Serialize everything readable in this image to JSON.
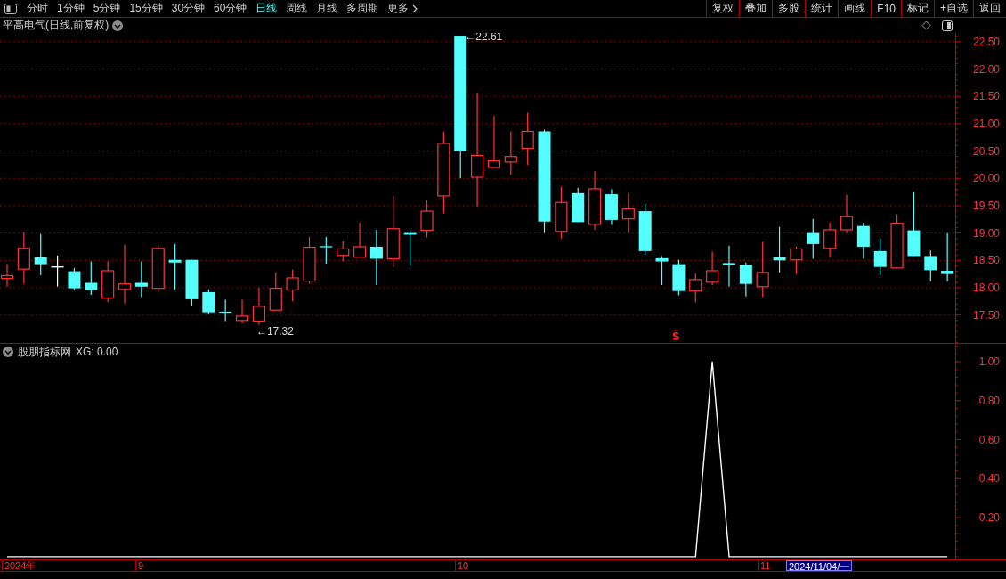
{
  "toolbar": {
    "periods": [
      {
        "label": "分时",
        "selected": false
      },
      {
        "label": "1分钟",
        "selected": false
      },
      {
        "label": "5分钟",
        "selected": false
      },
      {
        "label": "15分钟",
        "selected": false
      },
      {
        "label": "30分钟",
        "selected": false
      },
      {
        "label": "60分钟",
        "selected": false
      },
      {
        "label": "日线",
        "selected": true
      },
      {
        "label": "周线",
        "selected": false
      },
      {
        "label": "月线",
        "selected": false
      },
      {
        "label": "多周期",
        "selected": false
      }
    ],
    "more": "更多",
    "actions": [
      "复权",
      "叠加",
      "多股",
      "统计",
      "画线",
      "F10",
      "标记",
      "+自选",
      "返回"
    ]
  },
  "main_panel": {
    "title": "平高电气(日线,前复权)",
    "chart_data": {
      "type": "candlestick",
      "grid": true,
      "ylim": [
        16.99,
        22.66
      ],
      "yticks": [
        {
          "value": 17.5,
          "label": "17.50"
        },
        {
          "value": 18,
          "label": "18.00"
        },
        {
          "value": 18.5,
          "label": "18.50"
        },
        {
          "value": 19,
          "label": "19.00"
        },
        {
          "value": 19.5,
          "label": "19.50"
        },
        {
          "value": 20,
          "label": "20.00"
        },
        {
          "value": 20.5,
          "label": "20.50"
        },
        {
          "value": 21,
          "label": "21.00"
        },
        {
          "value": 21.5,
          "label": "21.50"
        },
        {
          "value": 22,
          "label": "22.00"
        },
        {
          "value": 22.5,
          "label": "22.50"
        }
      ],
      "ohlc": [
        [
          18.17,
          18.43,
          18.02,
          18.22
        ],
        [
          18.34,
          19.01,
          18.07,
          18.72
        ],
        [
          18.56,
          18.98,
          18.23,
          18.43
        ],
        [
          18.38,
          18.59,
          18.02,
          18.38
        ],
        [
          18.3,
          18.36,
          17.96,
          17.99
        ],
        [
          18.09,
          18.48,
          17.87,
          17.96
        ],
        [
          17.81,
          18.48,
          17.74,
          18.31
        ],
        [
          17.97,
          18.79,
          17.71,
          18.07
        ],
        [
          18.09,
          18.48,
          17.83,
          18.02
        ],
        [
          17.99,
          18.79,
          17.92,
          18.72
        ],
        [
          18.51,
          18.8,
          17.97,
          18.46
        ],
        [
          18.51,
          18.51,
          17.66,
          17.79
        ],
        [
          17.92,
          17.97,
          17.52,
          17.55
        ],
        [
          17.56,
          17.78,
          17.39,
          17.55
        ],
        [
          17.4,
          17.78,
          17.35,
          17.48
        ],
        [
          17.39,
          18.0,
          17.32,
          17.66
        ],
        [
          17.59,
          18.28,
          17.58,
          17.99
        ],
        [
          17.96,
          18.33,
          17.75,
          18.18
        ],
        [
          18.12,
          18.93,
          18.07,
          18.74
        ],
        [
          18.76,
          18.93,
          18.44,
          18.74
        ],
        [
          18.59,
          18.85,
          18.48,
          18.71
        ],
        [
          18.56,
          19.19,
          18.56,
          18.75
        ],
        [
          18.75,
          19.06,
          18.05,
          18.53
        ],
        [
          18.53,
          19.68,
          18.38,
          19.08
        ],
        [
          19.0,
          19.05,
          18.4,
          18.97
        ],
        [
          19.05,
          19.6,
          18.92,
          19.4
        ],
        [
          19.68,
          20.86,
          19.36,
          20.64
        ],
        [
          22.61,
          22.61,
          20.0,
          20.5
        ],
        [
          20.02,
          21.57,
          19.49,
          20.42
        ],
        [
          20.2,
          21.15,
          20.2,
          20.32
        ],
        [
          20.3,
          20.86,
          20.06,
          20.4
        ],
        [
          20.55,
          21.2,
          20.25,
          20.86
        ],
        [
          20.86,
          20.89,
          19.0,
          19.21
        ],
        [
          19.03,
          19.85,
          18.9,
          19.56
        ],
        [
          19.73,
          19.83,
          19.2,
          19.2
        ],
        [
          19.16,
          20.13,
          19.06,
          19.81
        ],
        [
          19.71,
          19.8,
          19.15,
          19.24
        ],
        [
          19.26,
          19.73,
          19.0,
          19.44
        ],
        [
          19.4,
          19.54,
          18.6,
          18.67
        ],
        [
          18.54,
          18.58,
          18.05,
          18.48
        ],
        [
          18.43,
          18.51,
          17.86,
          17.94
        ],
        [
          17.94,
          18.26,
          17.73,
          18.15
        ],
        [
          18.1,
          18.66,
          18.05,
          18.31
        ],
        [
          18.45,
          18.77,
          18.02,
          18.42
        ],
        [
          18.42,
          18.46,
          17.84,
          18.07
        ],
        [
          18.02,
          18.84,
          17.83,
          18.28
        ],
        [
          18.56,
          19.11,
          18.28,
          18.5
        ],
        [
          18.51,
          18.75,
          18.25,
          18.71
        ],
        [
          19.0,
          19.26,
          18.53,
          18.8
        ],
        [
          18.72,
          19.19,
          18.56,
          19.06
        ],
        [
          19.06,
          19.7,
          19.0,
          19.3
        ],
        [
          19.13,
          19.19,
          18.53,
          18.75
        ],
        [
          18.67,
          18.9,
          18.23,
          18.38
        ],
        [
          18.36,
          19.34,
          18.35,
          19.18
        ],
        [
          19.05,
          19.75,
          18.58,
          18.58
        ],
        [
          18.58,
          18.68,
          18.12,
          18.32
        ],
        [
          18.31,
          19.0,
          18.12,
          18.25
        ]
      ],
      "annotations": [
        "←22.61",
        "←17.32"
      ]
    },
    "signal_marker": "Ŝ"
  },
  "indicator_panel": {
    "name": "股朋指标网",
    "reading": "XG: 0.00",
    "chart_data": {
      "type": "line",
      "ylim": [
        -0.014,
        1.091
      ],
      "yticks": [
        {
          "value": 0.2,
          "label": "0.20"
        },
        {
          "value": 0.4,
          "label": "0.40"
        },
        {
          "value": 0.6,
          "label": "0.60"
        },
        {
          "value": 0.8,
          "label": "0.80"
        },
        {
          "value": 1,
          "label": "1.00"
        }
      ],
      "series": [
        {
          "color": "#ffffff",
          "values": [
            0,
            0,
            0,
            0,
            0,
            0,
            0,
            0,
            0,
            0,
            0,
            0,
            0,
            0,
            0,
            0,
            0,
            0,
            0,
            0,
            0,
            0,
            0,
            0,
            0,
            0,
            0,
            0,
            0,
            0,
            0,
            0,
            0,
            0,
            0,
            0,
            0,
            0,
            0,
            0,
            0,
            0,
            1,
            0,
            0,
            0,
            0,
            0,
            0,
            0,
            0,
            0,
            0,
            0,
            0,
            0,
            0
          ]
        }
      ]
    }
  },
  "date_axis": {
    "labels": [
      "2024年",
      "9",
      "10",
      "11"
    ],
    "cursor_date": "2024/11/04/一"
  }
}
